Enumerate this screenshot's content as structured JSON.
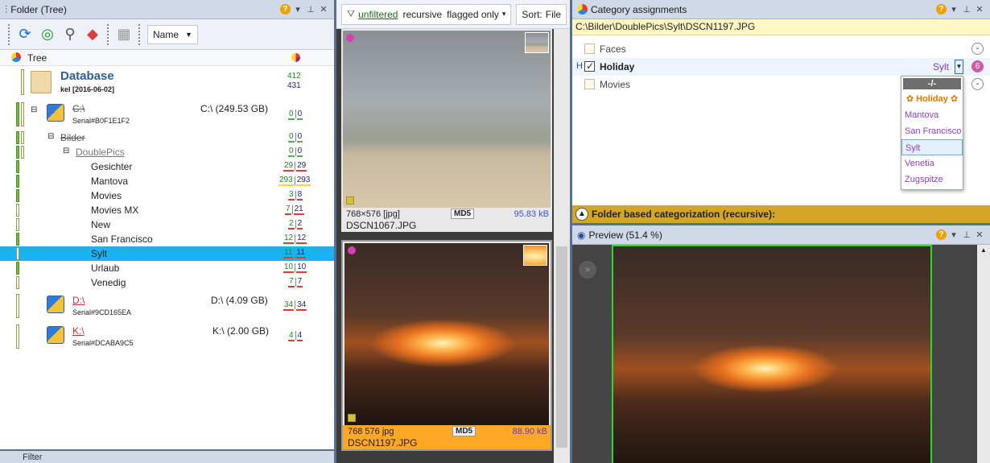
{
  "folder_panel": {
    "title": "Folder (Tree)",
    "sort_label": "Name",
    "tree_header": "Tree",
    "database": {
      "name": "Database",
      "sub": "kel [2016-06-02]",
      "count_a": "412",
      "count_b": "431"
    },
    "drives": [
      {
        "name": "C:\\",
        "serial": "Serial#B0F1E1F2",
        "size": "C:\\  (249.53 GB)",
        "a": "0",
        "b": "0"
      },
      {
        "name": "D:\\",
        "serial": "Serial#9CD165EA",
        "size": "D:\\  (4.09 GB)",
        "a": "34",
        "b": "34"
      },
      {
        "name": "K:\\",
        "serial": "Serial#DCABA9C5",
        "size": "K:\\  (2.00 GB)",
        "a": "4",
        "b": "4"
      }
    ],
    "folders": [
      {
        "name": "Bilder",
        "a": "0",
        "b": "0"
      },
      {
        "name": "DoublePics",
        "a": "0",
        "b": "0"
      },
      {
        "name": "Gesichter",
        "a": "29",
        "b": "29"
      },
      {
        "name": "Mantova",
        "a": "293",
        "b": "293"
      },
      {
        "name": "Movies",
        "a": "3",
        "b": "8"
      },
      {
        "name": "Movies MX",
        "a": "7",
        "b": "21"
      },
      {
        "name": "New",
        "a": "2",
        "b": "2"
      },
      {
        "name": "San Francisco",
        "a": "12",
        "b": "12"
      },
      {
        "name": "Sylt",
        "a": "11",
        "b": "11"
      },
      {
        "name": "Urlaub",
        "a": "10",
        "b": "10"
      },
      {
        "name": "Venedig",
        "a": "7",
        "b": "7"
      }
    ]
  },
  "thumbs_panel": {
    "filter_label": "unfiltered",
    "recursive_label": "recursive",
    "flagged_label": "flagged only",
    "sort_label": "Sort:",
    "sort_value": "File",
    "items": [
      {
        "dims": "768×576 [jpg]",
        "md5": "MD5",
        "size": "95.83 kB",
        "name": "DSCN1067.JPG"
      },
      {
        "dims": "768  576  jpg",
        "md5": "MD5",
        "size": "88.90 kB",
        "name": "DSCN1197.JPG"
      }
    ]
  },
  "category_panel": {
    "title": "Category assignments",
    "path": "C:\\Bilder\\DoublePics\\Sylt\\DSCN1197.JPG",
    "categories": [
      {
        "name": "Faces",
        "checked": false
      },
      {
        "prefix": "H",
        "name": "Holiday",
        "checked": true,
        "value": "Sylt",
        "badge": "6"
      },
      {
        "name": "Movies",
        "checked": false
      }
    ],
    "dropdown": {
      "header": "-/-",
      "items": [
        "✿ Holiday ✿",
        "Mantova",
        "San Francisco",
        "Sylt",
        "Venetia",
        "Zugspitze"
      ]
    },
    "folder_based": "Folder based categorization (recursive):"
  },
  "preview_panel": {
    "title": "Preview (51.4 %)"
  },
  "filter_panel_stub": {
    "title": "Filter"
  },
  "colors": {
    "selection": "#19b4ef",
    "selected_card": "#ffa726",
    "accent_gold": "#d4a625"
  },
  "icons": [
    "refresh-icon",
    "fingerprint-icon",
    "search-icon",
    "categorize-icon",
    "grid-icon",
    "funnel-icon",
    "eye-icon",
    "pin-icon",
    "close-icon"
  ]
}
